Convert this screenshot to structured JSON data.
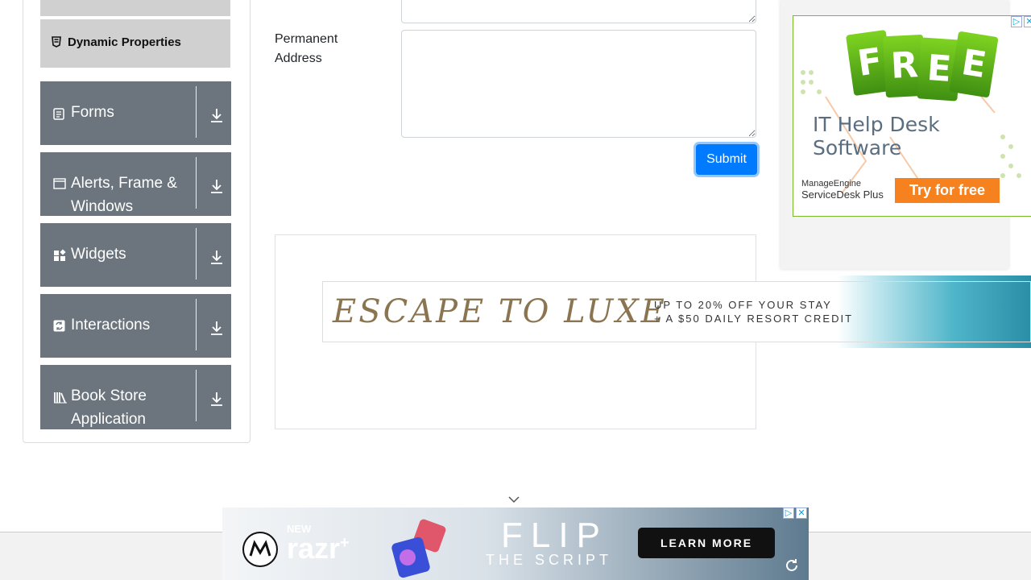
{
  "sidebar": {
    "dynamic_properties": "Dynamic Properties",
    "groups": [
      {
        "label": "Forms",
        "icon": "form-icon"
      },
      {
        "label": "Alerts, Frame & Windows",
        "icon": "window-icon"
      },
      {
        "label": "Widgets",
        "icon": "widgets-icon"
      },
      {
        "label": "Interactions",
        "icon": "interactions-icon"
      },
      {
        "label": "Book Store Application",
        "icon": "books-icon"
      }
    ]
  },
  "form": {
    "permanent_address_label": "Permanent Address",
    "submit_label": "Submit"
  },
  "ads": {
    "right": {
      "free_letters": [
        "F",
        "R",
        "E",
        "E"
      ],
      "headline": "IT Help Desk Software",
      "brand": "ManageEngine",
      "product": "ServiceDesk Plus",
      "cta": "Try for free"
    },
    "luxe": {
      "headline": "ESCAPE TO LUXE",
      "line1": "UP TO 20% OFF YOUR STAY",
      "line2": "+ A $50 DAILY RESORT CREDIT"
    },
    "bottom": {
      "new": "NEW",
      "brand": "razr",
      "plus": "+",
      "title": "FLIP",
      "subtitle": "THE SCRIPT",
      "cta": "LEARN MORE"
    }
  },
  "colors": {
    "primary": "#007bff",
    "sidebar_group": "#6c757d",
    "sidebar_subitem": "#d0d0d0",
    "cta_orange": "#f5821f",
    "free_green": "#5fb31a"
  }
}
